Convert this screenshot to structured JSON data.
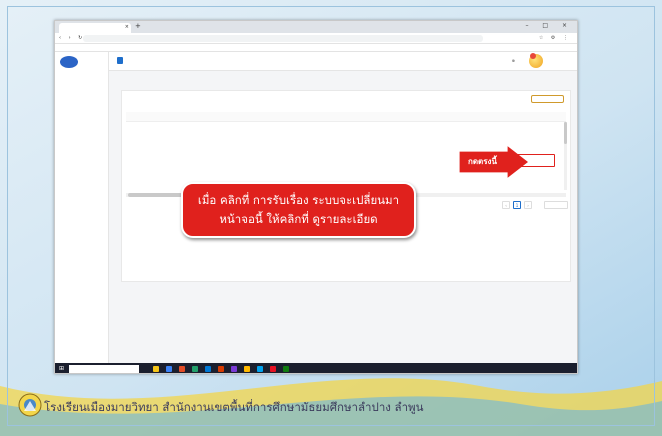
{
  "browser": {
    "tab_title": "",
    "url": "",
    "bookmarks": [],
    "nav_glyphs": "‹ › ↻",
    "window_controls": "– □ ×"
  },
  "sidebar": {
    "logo_text": "",
    "items": []
  },
  "topbar": {
    "org_name": "",
    "org_sub": "",
    "lang": "",
    "notification_count": "",
    "user_name": ""
  },
  "breadcrumb": "",
  "card": {
    "title": "",
    "action_label": "",
    "columns": [],
    "rows": [],
    "detail_label": "",
    "pagination": {
      "pages": [
        "‹",
        "1",
        "›"
      ],
      "page_size": ""
    },
    "total_text": ""
  },
  "overlay": {
    "callout_line1": "เมื่อ คลิกที่ การรับเรื่อง ระบบจะเปลี่ยนมา",
    "callout_line2": "หน้าจอนี้ ให้คลิกที่ ดูรายละเอียด",
    "arrow_label": "กดตรงนี้",
    "accent_color": "#e0211d"
  },
  "taskbar": {
    "search_placeholder": "",
    "tray_text": ""
  },
  "footer": {
    "text": "โรงเรียนเมืองมายวิทยา  สำนักงานเขตพื้นที่การศึกษามัธยมศึกษาลำปาง  ลำพูน"
  },
  "colors": {
    "primary": "#1e6ecb",
    "button": "#1f8dea",
    "gold": "#d09a2c",
    "callout": "#e0211d"
  }
}
